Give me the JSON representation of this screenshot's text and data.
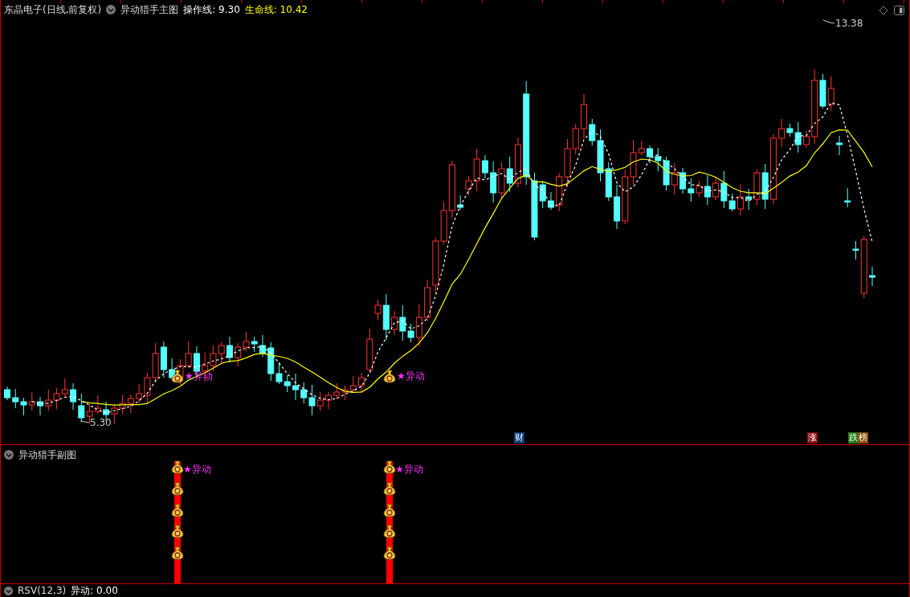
{
  "header": {
    "title": "东晶电子(日线,前复权)",
    "indicator": "异动猎手主图",
    "lines": [
      {
        "label": "操作线: 9.30",
        "color": "#ffffff"
      },
      {
        "label": "生命线: 10.42",
        "color": "#ffff00"
      }
    ]
  },
  "main_chart": {
    "high_label": "13.38",
    "low_label": "5.30",
    "signals": [
      {
        "label": "★异动"
      },
      {
        "label": "★异动"
      }
    ],
    "badges": [
      {
        "label": "财",
        "color": "#0a3c78"
      },
      {
        "label": "涨",
        "color": "#8b0a0a"
      },
      {
        "label": "跌",
        "color": "#1f7a14"
      },
      {
        "label": "榜",
        "color": "#8a4a06"
      }
    ]
  },
  "sub_chart": {
    "title": "异动猎手副图",
    "signals": [
      {
        "label": "★异动"
      },
      {
        "label": "★异动"
      }
    ]
  },
  "bottom_panel": {
    "title": "RSV(12,3)",
    "reading": "异动: 0.00"
  }
}
